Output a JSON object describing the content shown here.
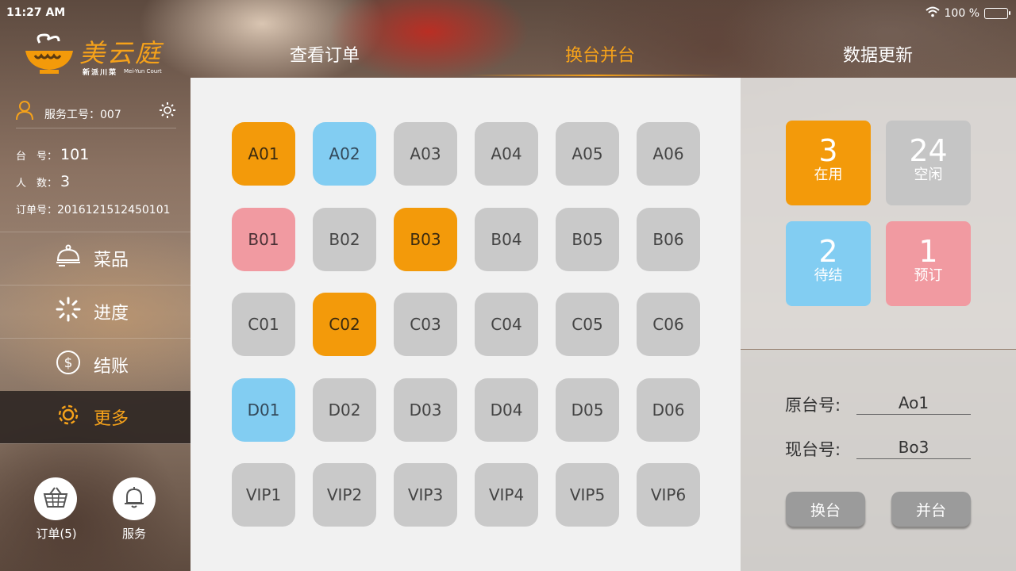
{
  "status_bar": {
    "time": "11:27 AM",
    "battery": "100 %"
  },
  "logo": {
    "title": "美云庭",
    "sub_cn": "新派川菜",
    "sub_en": "Mei-Yun Court"
  },
  "tabs": [
    {
      "label": "查看订单"
    },
    {
      "label": "换台并台"
    },
    {
      "label": "数据更新"
    }
  ],
  "sidebar": {
    "staff_label": "服务工号：007",
    "table_label": "台　号：",
    "table_value": "101",
    "people_label": "人　数：",
    "people_value": "3",
    "order_label": "订单号：",
    "order_value": "2016121512450101",
    "menu": [
      {
        "label": "菜品",
        "icon": "cloche-icon"
      },
      {
        "label": "进度",
        "icon": "spinner-icon"
      },
      {
        "label": "结账",
        "icon": "dollar-icon"
      },
      {
        "label": "更多",
        "icon": "gear-icon"
      }
    ],
    "orders_label": "订单(5)",
    "service_label": "服务"
  },
  "tables": [
    {
      "id": "A01",
      "status": "inuse"
    },
    {
      "id": "A02",
      "status": "pending"
    },
    {
      "id": "A03",
      "status": "idle"
    },
    {
      "id": "A04",
      "status": "idle"
    },
    {
      "id": "A05",
      "status": "idle"
    },
    {
      "id": "A06",
      "status": "idle"
    },
    {
      "id": "B01",
      "status": "reserved"
    },
    {
      "id": "B02",
      "status": "idle"
    },
    {
      "id": "B03",
      "status": "inuse"
    },
    {
      "id": "B04",
      "status": "idle"
    },
    {
      "id": "B05",
      "status": "idle"
    },
    {
      "id": "B06",
      "status": "idle"
    },
    {
      "id": "C01",
      "status": "idle"
    },
    {
      "id": "C02",
      "status": "inuse"
    },
    {
      "id": "C03",
      "status": "idle"
    },
    {
      "id": "C04",
      "status": "idle"
    },
    {
      "id": "C05",
      "status": "idle"
    },
    {
      "id": "C06",
      "status": "idle"
    },
    {
      "id": "D01",
      "status": "pending"
    },
    {
      "id": "D02",
      "status": "idle"
    },
    {
      "id": "D03",
      "status": "idle"
    },
    {
      "id": "D04",
      "status": "idle"
    },
    {
      "id": "D05",
      "status": "idle"
    },
    {
      "id": "D06",
      "status": "idle"
    },
    {
      "id": "VIP1",
      "status": "idle"
    },
    {
      "id": "VIP2",
      "status": "idle"
    },
    {
      "id": "VIP3",
      "status": "idle"
    },
    {
      "id": "VIP4",
      "status": "idle"
    },
    {
      "id": "VIP5",
      "status": "idle"
    },
    {
      "id": "VIP6",
      "status": "idle"
    }
  ],
  "stats": {
    "inuse": {
      "count": "3",
      "label": "在用"
    },
    "idle": {
      "count": "24",
      "label": "空闲"
    },
    "pending": {
      "count": "2",
      "label": "待结"
    },
    "reserved": {
      "count": "1",
      "label": "预订"
    }
  },
  "transfer": {
    "original_label": "原台号:",
    "original_value": "Ao1",
    "current_label": "现台号:",
    "current_value": "Bo3",
    "swap_button": "换台",
    "merge_button": "并台"
  },
  "colors": {
    "accent": "#f39a0a",
    "pending": "#82cdf2",
    "reserved": "#f19aa1",
    "idle": "#c9c9c9"
  }
}
